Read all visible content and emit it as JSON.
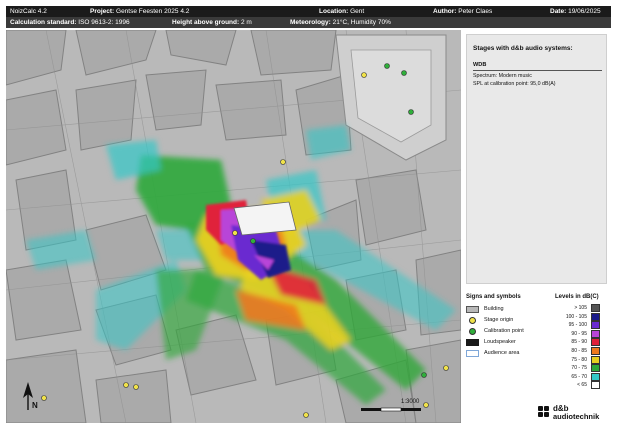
{
  "header": {
    "app": "NoizCalc 4.2",
    "project_label": "Project:",
    "project": "Gentse Feesten 2025 4.2",
    "location_label": "Location:",
    "location": "Gent",
    "author_label": "Author:",
    "author": "Peter Claes",
    "date_label": "Date:",
    "date": "19/06/2025",
    "calc_label": "Calculation standard:",
    "calc": "ISO 9613-2: 1996",
    "height_label": "Height above ground:",
    "height": "2 m",
    "meteo_label": "Meteorology:",
    "meteo": "21°C, Humidity 70%"
  },
  "map": {
    "scale_text": "1:3000",
    "north_label": "N"
  },
  "stages_panel": {
    "title": "Stages with d&b audio systems:",
    "stage_name": "WDB",
    "spectrum": "Spectrum: Modern music",
    "spl": "SPL at calibration point: 95,0 dB(A)"
  },
  "signs": {
    "title": "Signs and symbols",
    "items": [
      {
        "label": "Building",
        "swatch": "#b8b8b8",
        "border": "#555555"
      },
      {
        "label": "Stage origin",
        "swatch": "#f0e24a",
        "border": "#333333"
      },
      {
        "label": "Calibration point",
        "swatch": "#2fae3a",
        "border": "#333333"
      },
      {
        "label": "Loudspeaker",
        "swatch": "#1a1a1a",
        "border": "#1a1a1a"
      },
      {
        "label": "Audience area",
        "swatch": "#ffffff",
        "border": "#7fa7d8"
      }
    ]
  },
  "levels": {
    "title": "Levels in dB(C)",
    "items": [
      {
        "label": "> 105",
        "color": "#555555"
      },
      {
        "label": "100 - 105",
        "color": "#1a1a8a"
      },
      {
        "label": "95 - 100",
        "color": "#6a2ad0"
      },
      {
        "label": "90 - 95",
        "color": "#b845d8"
      },
      {
        "label": "85 - 90",
        "color": "#e0203a"
      },
      {
        "label": "80 - 85",
        "color": "#ef7a1e"
      },
      {
        "label": "75 - 80",
        "color": "#e8d020"
      },
      {
        "label": "70 - 75",
        "color": "#2fa83a"
      },
      {
        "label": "65 - 70",
        "color": "#33c7c7"
      },
      {
        "label": "< 65",
        "color": "#ffffff"
      }
    ]
  },
  "logo": {
    "line1": "d&b",
    "line2": "audiotechnik"
  }
}
